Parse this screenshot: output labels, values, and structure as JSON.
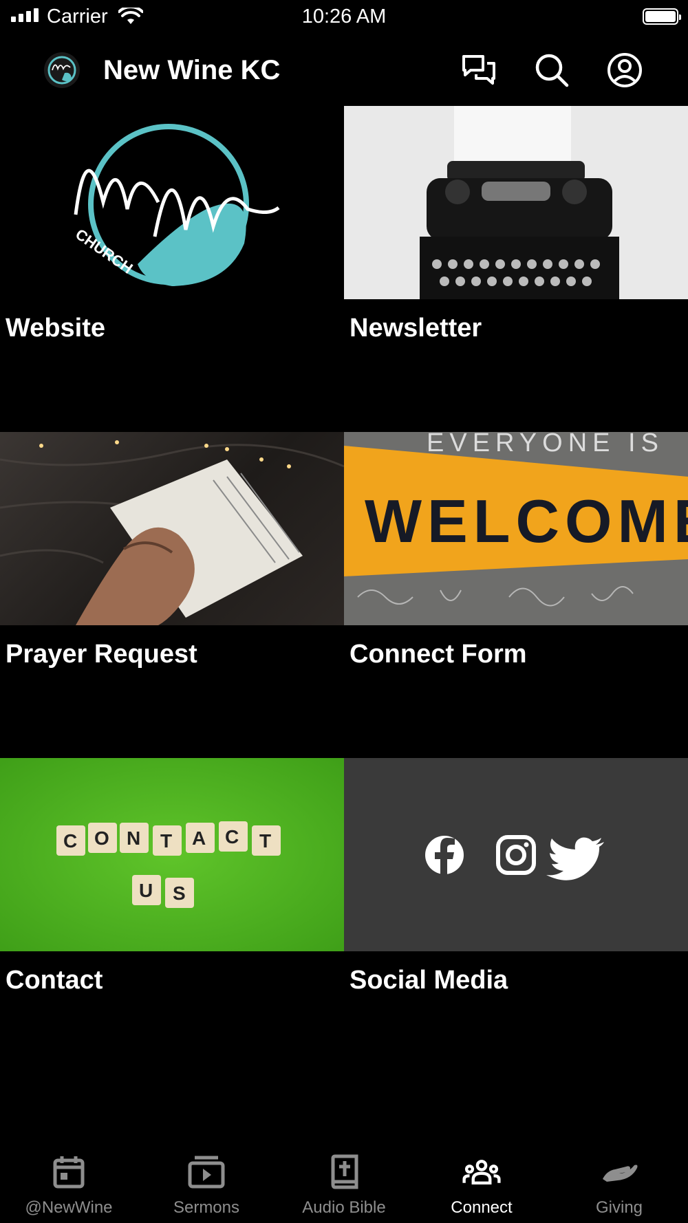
{
  "status_bar": {
    "carrier": "Carrier",
    "time": "10:26 AM"
  },
  "header": {
    "title": "New Wine KC"
  },
  "tiles": [
    {
      "label": "Website"
    },
    {
      "label": "Newsletter"
    },
    {
      "label": "Prayer Request"
    },
    {
      "label": "Connect Form"
    },
    {
      "label": "Contact"
    },
    {
      "label": "Social Media"
    }
  ],
  "welcome_banner": {
    "top_text": "EVERYONE IS",
    "main_text": "WELCOME"
  },
  "contact_tiles": {
    "row1": [
      "C",
      "O",
      "N",
      "T",
      "A",
      "C",
      "T"
    ],
    "row2": [
      "U",
      "S"
    ]
  },
  "tabs": [
    {
      "label": "@NewWine",
      "icon": "calendar-icon"
    },
    {
      "label": "Sermons",
      "icon": "play-icon"
    },
    {
      "label": "Audio Bible",
      "icon": "bible-icon"
    },
    {
      "label": "Connect",
      "icon": "people-icon",
      "active": true
    },
    {
      "label": "Giving",
      "icon": "giving-hand-icon"
    }
  ],
  "colors": {
    "background": "#000000",
    "accent_teal": "#5bc2c6",
    "social_bg": "#3a3a3a",
    "inactive_tab": "#8e8e8e"
  }
}
